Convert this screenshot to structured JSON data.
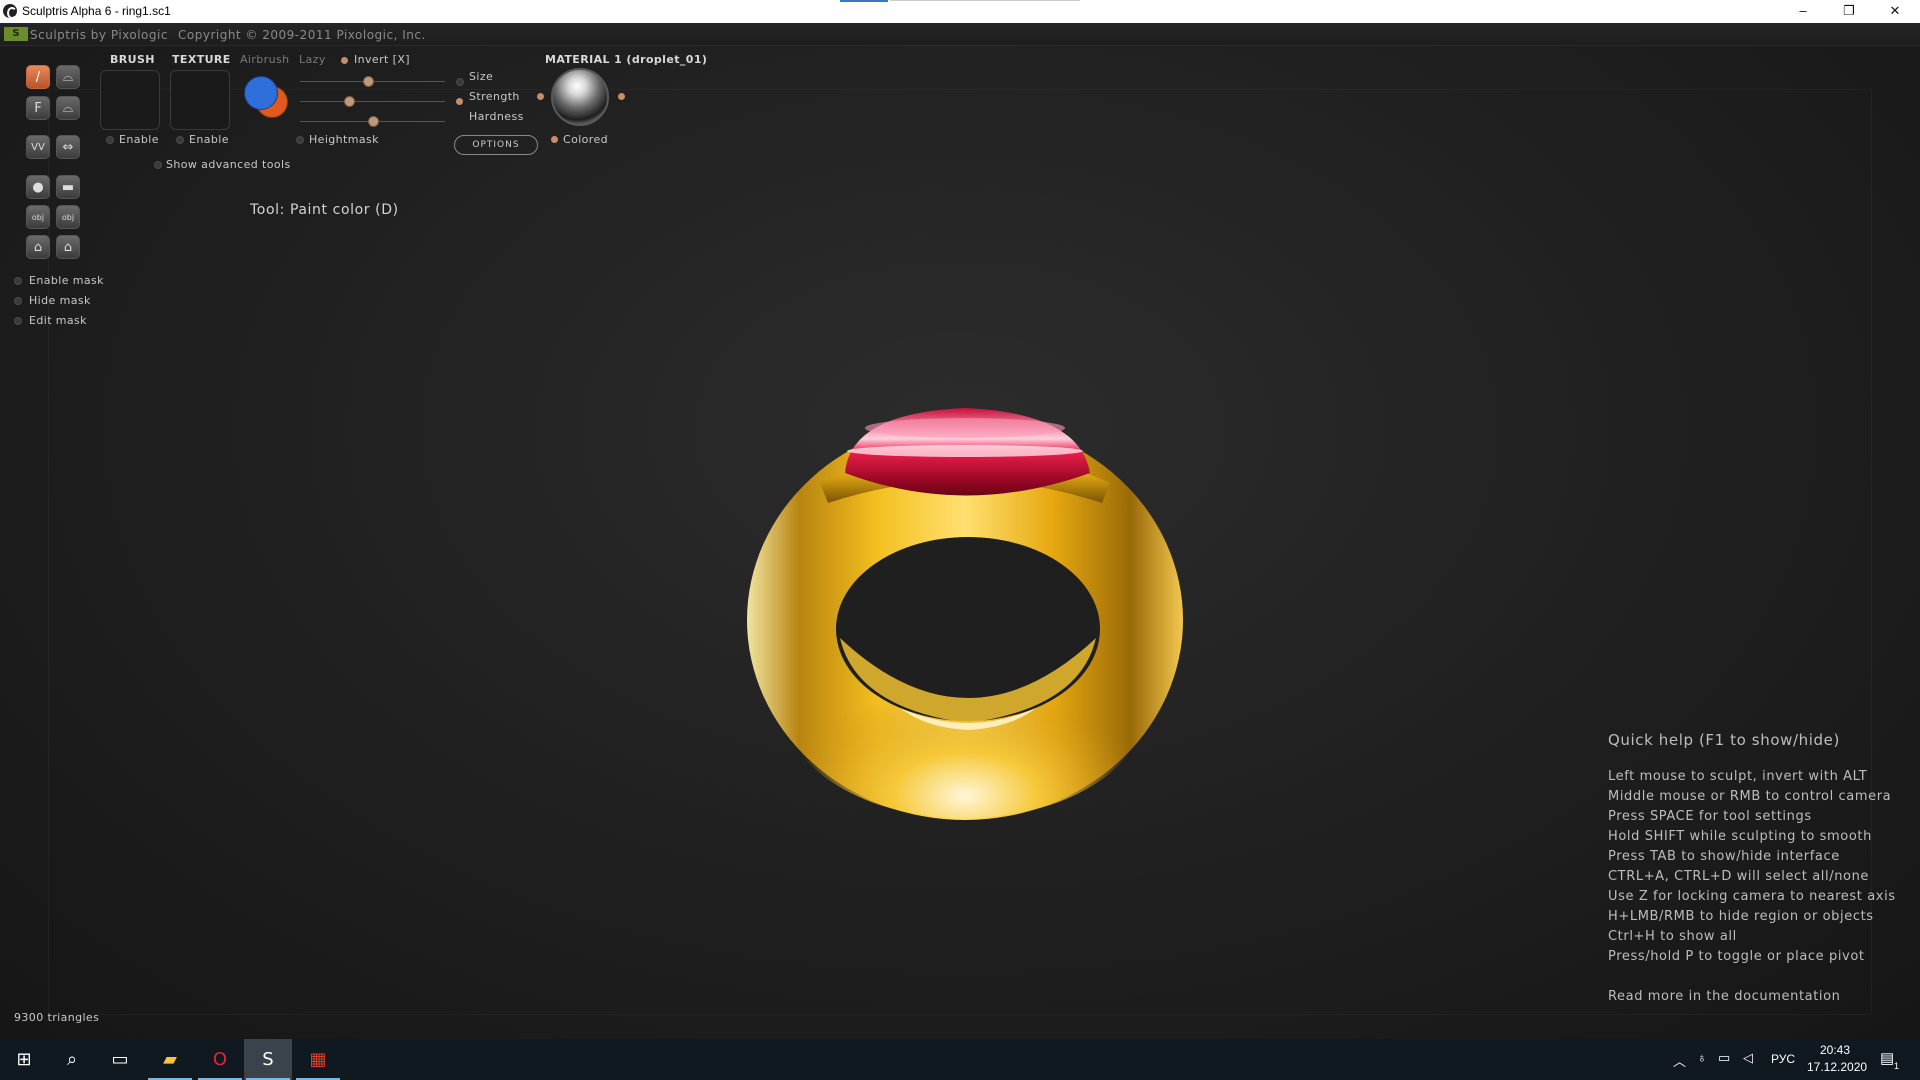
{
  "window": {
    "title": "Sculptris Alpha 6 - ring1.sc1",
    "minimize": "–",
    "maximize": "❐",
    "close": "✕"
  },
  "menu": {
    "logo": "S",
    "app_name": "Sculptris by Pixologic",
    "copyright": "Copyright © 2009-2011 Pixologic, Inc."
  },
  "panel": {
    "brush_label": "BRUSH",
    "texture_label": "TEXTURE",
    "airbrush_label": "Airbrush",
    "lazy_label": "Lazy",
    "invert_label": "Invert [X]",
    "brush_enable": "Enable",
    "texture_enable": "Enable",
    "heightmask_label": "Heightmask",
    "size_label": "Size",
    "strength_label": "Strength",
    "hardness_label": "Hardness",
    "options_label": "OPTIONS",
    "material_label": "MATERIAL 1 (droplet_01)",
    "colored_label": "Colored",
    "show_advanced": "Show advanced tools",
    "size_value": 0.47,
    "strength_value": 0.34,
    "hardness_value": 0.5,
    "primary_color": "#2f6fdc",
    "secondary_color": "#e05a1e"
  },
  "tool_status": "Tool: Paint color (D)",
  "mask": {
    "enable": "Enable mask",
    "hide": "Hide mask",
    "edit": "Edit mask"
  },
  "tools": [
    {
      "name": "paint-brush-icon",
      "glyph": "/"
    },
    {
      "name": "bumpy-icon",
      "glyph": "⌓"
    },
    {
      "name": "flatten-icon",
      "glyph": "F"
    },
    {
      "name": "smooth-icon",
      "glyph": "⌓"
    },
    {
      "name": "crease-icon",
      "glyph": "VV"
    },
    {
      "name": "grab-icon",
      "glyph": "⇔"
    },
    {
      "name": "sphere-icon",
      "glyph": "●"
    },
    {
      "name": "plane-icon",
      "glyph": "▬"
    },
    {
      "name": "import-obj-icon",
      "glyph": "obj"
    },
    {
      "name": "export-obj-icon",
      "glyph": "obj"
    },
    {
      "name": "lock-icon",
      "glyph": "⌂"
    },
    {
      "name": "save-icon",
      "glyph": "⌂"
    }
  ],
  "triangles": "9300 triangles",
  "help": {
    "title": "Quick help (F1 to show/hide)",
    "lines": [
      "Left mouse to sculpt, invert with ALT",
      "Middle mouse or RMB to control camera",
      "Press SPACE for tool settings",
      "Hold SHIFT while sculpting to smooth",
      "Press TAB to show/hide interface",
      "CTRL+A, CTRL+D will select all/none",
      "Use Z for locking camera to nearest axis",
      "H+LMB/RMB to hide region or objects",
      "Ctrl+H to show all",
      "Press/hold P to toggle or place pivot"
    ],
    "doc_link": "Read more in the documentation"
  },
  "taskbar": {
    "time": "20:43",
    "date": "17.12.2020",
    "lang": "РУС",
    "notif_count": "1"
  }
}
